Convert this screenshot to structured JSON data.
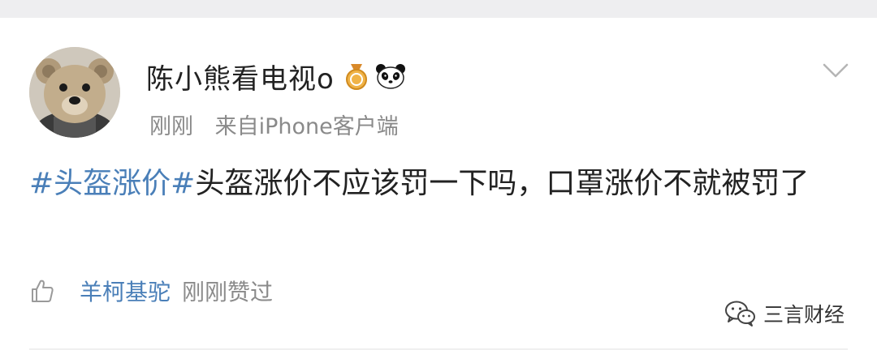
{
  "post": {
    "author": "陈小熊看电视o",
    "time": "刚刚",
    "source": "来自iPhone客户端",
    "content": {
      "hashtag": "#头盔涨价#",
      "text": "头盔涨价不应该罚一下吗，口罩涨价不就被罚了"
    },
    "like_footer": {
      "liker_name": "羊柯基驼",
      "liked_text": "刚刚赞过"
    }
  },
  "watermark": {
    "text": "三言财经"
  },
  "icons": {
    "avatar": "bear-avatar",
    "badge": "medal-badge-icon",
    "emoji": "panda-icon",
    "menu": "chevron-down-icon",
    "like": "thumbs-up-icon",
    "watermark": "wechat-icon"
  },
  "colors": {
    "link": "#4a7fb8",
    "text": "#222222",
    "muted": "#8a8a8a",
    "badge": "#e8a93a"
  }
}
